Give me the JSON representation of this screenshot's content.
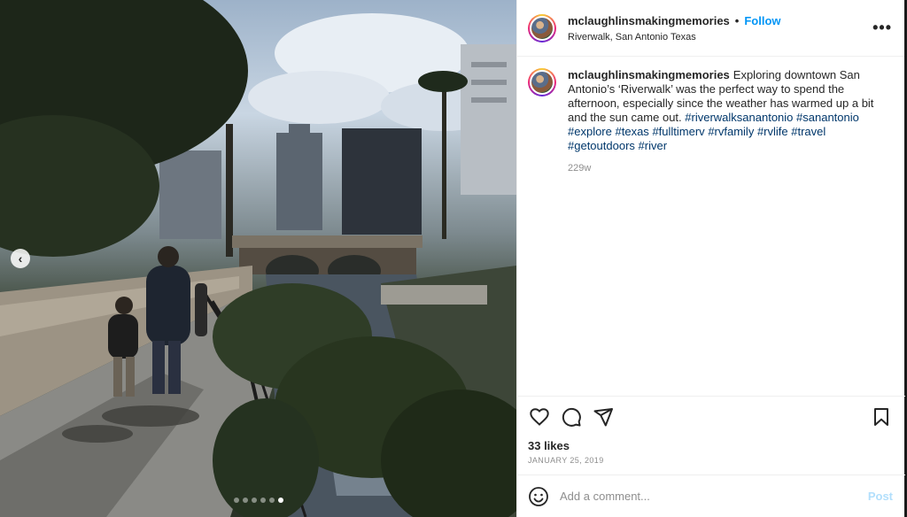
{
  "post": {
    "username": "mclaughlinsmakingmemories",
    "separator": "•",
    "follow_label": "Follow",
    "location": "Riverwalk, San Antonio Texas",
    "more_label": "•••"
  },
  "photo": {
    "prev_arrow": "‹",
    "carousel": {
      "count": 6,
      "active_index": 5
    }
  },
  "caption": {
    "username": "mclaughlinsmakingmemories",
    "text": "Exploring downtown San Antonio’s ‘Riverwalk’ was the perfect way to spend the afternoon, especially since the weather has warmed up a bit and the sun came out.",
    "hashtags": [
      "#riverwalksanantonio",
      "#sanantonio",
      "#explore",
      "#texas",
      "#fulltimerv",
      "#rvfamily",
      "#rvlife",
      "#travel",
      "#getoutdoors",
      "#river"
    ],
    "time": "229w"
  },
  "actions": {
    "icons": [
      "heart-icon",
      "comment-icon",
      "share-icon",
      "bookmark-icon"
    ],
    "likes": "33 likes",
    "date": "JANUARY 25, 2019"
  },
  "comment_box": {
    "placeholder": "Add a comment...",
    "post_label": "Post",
    "emoji_icon": "smiley-icon"
  },
  "colors": {
    "link": "#0095f6",
    "hashtag": "#00376b",
    "muted": "#8e8e8e",
    "post_disabled": "#b2dffc"
  }
}
